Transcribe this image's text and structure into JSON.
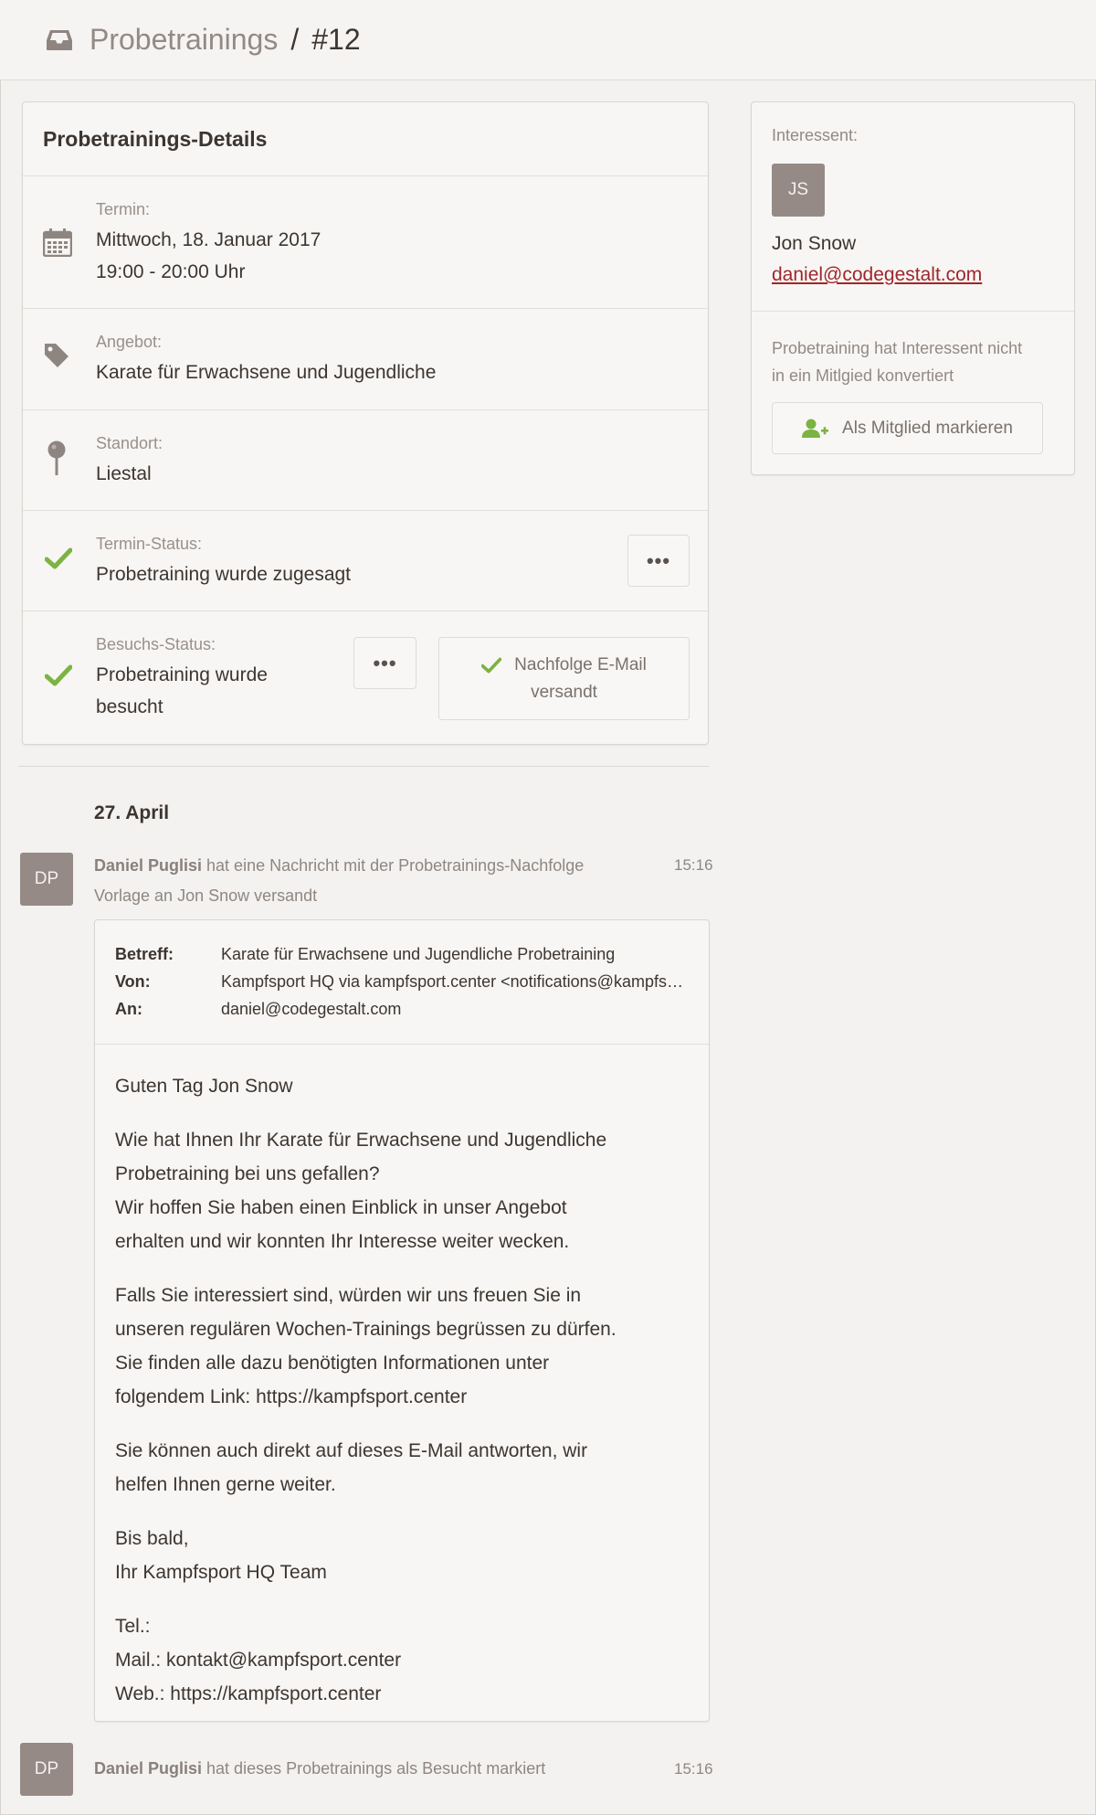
{
  "header": {
    "section": "Probetrainings",
    "separator": "/",
    "current": "#12"
  },
  "details": {
    "title": "Probetrainings-Details",
    "termin": {
      "label": "Termin:",
      "date": "Mittwoch, 18. Januar 2017",
      "time": "19:00 - 20:00 Uhr"
    },
    "angebot": {
      "label": "Angebot:",
      "value": "Karate für Erwachsene und Jugendliche"
    },
    "standort": {
      "label": "Standort:",
      "value": "Liestal"
    },
    "termin_status": {
      "label": "Termin-Status:",
      "value": "Probetraining wurde zugesagt",
      "menu": "•••"
    },
    "besuchs_status": {
      "label": "Besuchs-Status:",
      "line1": "Probetraining wurde",
      "line2": "besucht",
      "menu": "•••",
      "followup_line1": "Nachfolge E-Mail",
      "followup_line2": "versandt"
    }
  },
  "prospect": {
    "label": "Interessent:",
    "initials": "JS",
    "name": "Jon Snow",
    "email": "daniel@codegestalt.com",
    "note_line1": "Probetraining hat Interessent nicht",
    "note_line2": "in ein Mitlgied konvertiert",
    "member_button": "Als Mitglied markieren"
  },
  "feed": {
    "date": "27. April",
    "entry1": {
      "initials": "DP",
      "author": "Daniel Puglisi",
      "text_line1": " hat eine Nachricht mit der Probetrainings-Nachfolge",
      "text_line2": "Vorlage an Jon Snow versandt",
      "time": "15:16"
    },
    "mail": {
      "subject_label": "Betreff:",
      "subject": "Karate für Erwachsene und Jugendliche Probetraining",
      "from_label": "Von:",
      "from": "Kampfsport HQ via kampfsport.center <notifications@kampfsport.center>",
      "to_label": "An:",
      "to": "daniel@codegestalt.com",
      "greeting": "Guten Tag Jon Snow",
      "p1_l1": "Wie hat Ihnen Ihr Karate für Erwachsene und Jugendliche",
      "p1_l2": "Probetraining bei uns gefallen?",
      "p1_l3": "Wir hoffen Sie haben einen Einblick in unser Angebot",
      "p1_l4": "erhalten und wir konnten Ihr Interesse weiter wecken.",
      "p2_l1": "Falls Sie interessiert sind, würden wir uns freuen Sie in",
      "p2_l2": "unseren regulären Wochen-Trainings begrüssen zu dürfen.",
      "p2_l3": "Sie finden alle dazu benötigten Informationen unter",
      "p2_l4": "folgendem Link: https://kampfsport.center",
      "p3_l1": "Sie können auch direkt auf dieses E-Mail antworten, wir",
      "p3_l2": "helfen Ihnen gerne weiter.",
      "p4_l1": "Bis bald,",
      "p4_l2": "Ihr Kampfsport HQ Team",
      "p5_l1": "Tel.:",
      "p5_l2": "Mail.: kontakt@kampfsport.center",
      "p5_l3": "Web.: https://kampfsport.center"
    },
    "entry2": {
      "initials": "DP",
      "author": "Daniel Puglisi",
      "text": " hat dieses Probetrainings als Besucht markiert",
      "time": "15:16"
    }
  },
  "colors": {
    "accent_green": "#7cb342",
    "avatar": "#958a85",
    "link": "#a0262b"
  }
}
